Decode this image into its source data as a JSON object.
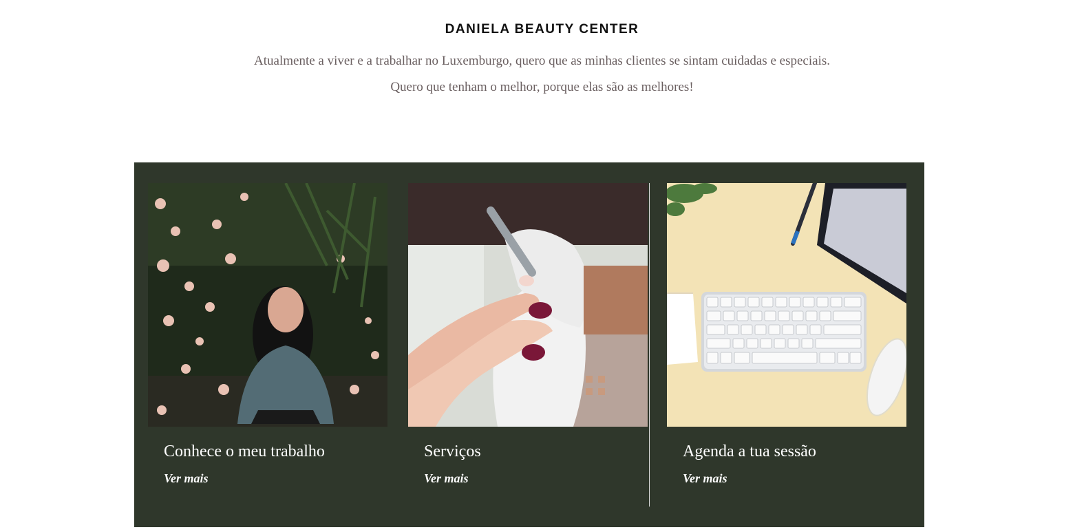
{
  "intro": {
    "title": "DANIELA BEAUTY CENTER",
    "line1": "Atualmente a viver e a trabalhar no Luxemburgo, quero que as minhas clientes se sintam cuidadas e especiais.",
    "line2": "Quero que tenham o melhor, porque elas são as melhores!"
  },
  "cards": [
    {
      "title": "Conhece o meu trabalho",
      "link": "Ver mais",
      "image": "woman-among-flowers-photo"
    },
    {
      "title": "Serviços",
      "link": "Ver mais",
      "image": "manicure-nails-photo"
    },
    {
      "title": "Agenda a tua sessão",
      "link": "Ver mais",
      "image": "desk-keyboard-photo"
    }
  ],
  "colors": {
    "panel": "#2f372b",
    "intro_text": "#6a5f60",
    "heading": "#111111"
  }
}
